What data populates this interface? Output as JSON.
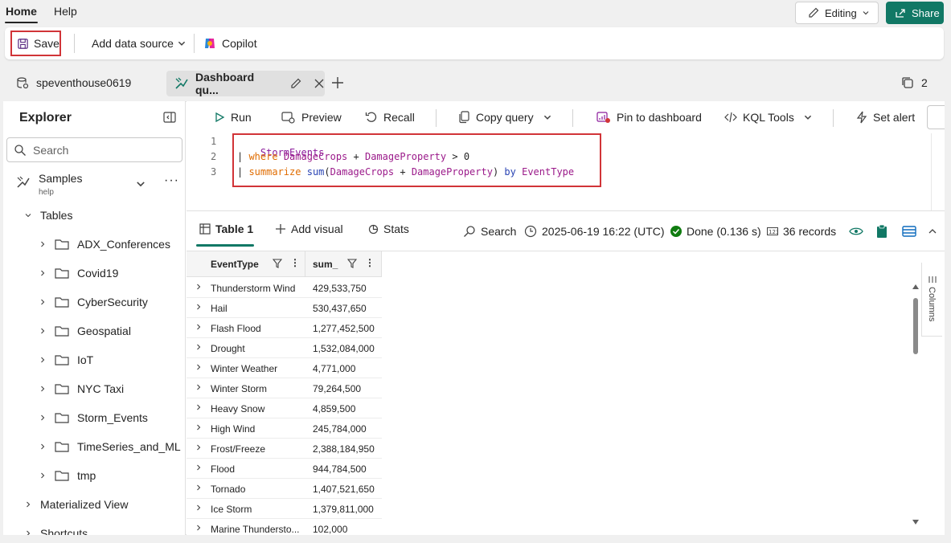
{
  "menubar": {
    "tabs": [
      "Home",
      "Help"
    ],
    "editing_label": "Editing",
    "share_label": "Share"
  },
  "ribbon": {
    "save_label": "Save",
    "add_data_source_label": "Add data source",
    "copilot_label": "Copilot"
  },
  "tabs": {
    "database": "speventhouse0619",
    "queryset": "Dashboard qu...",
    "count": "2"
  },
  "explorer": {
    "title": "Explorer",
    "search_placeholder": "Search",
    "samples_label": "Samples",
    "samples_sub": "help",
    "tables_label": "Tables",
    "tables": [
      "ADX_Conferences",
      "Covid19",
      "CyberSecurity",
      "Geospatial",
      "IoT",
      "NYC Taxi",
      "Storm_Events",
      "TimeSeries_and_ML",
      "tmp"
    ],
    "materialized_view_label": "Materialized View",
    "shortcuts_label": "Shortcuts"
  },
  "toolbar": {
    "run": "Run",
    "preview": "Preview",
    "recall": "Recall",
    "copy_query": "Copy query",
    "pin": "Pin to dashboard",
    "kql_tools": "KQL Tools",
    "set_alert": "Set alert"
  },
  "editor": {
    "line_numbers": [
      "1",
      "2",
      "3"
    ],
    "line1": "StormEvents",
    "line2": {
      "pipe": "| ",
      "op": "where",
      "a": "DamageCrops",
      "plus": " + ",
      "b": "DamageProperty",
      "rest": " > 0"
    },
    "line3": {
      "pipe": "| ",
      "op": "summarize",
      "fn": "sum",
      "open": "(",
      "a": "DamageCrops",
      "plus": " + ",
      "b": "DamageProperty",
      "close": ") ",
      "by": "by",
      "col": "EventType"
    }
  },
  "results": {
    "table_tab": "Table 1",
    "add_visual": "Add visual",
    "stats": "Stats",
    "search": "Search",
    "timestamp": "2025-06-19 16:22 (UTC)",
    "status": "Done (0.136 s)",
    "records": "36 records"
  },
  "grid": {
    "columns": [
      "EventType",
      "sum_"
    ],
    "rows": [
      [
        "Thunderstorm Wind",
        "429,533,750"
      ],
      [
        "Hail",
        "530,437,650"
      ],
      [
        "Flash Flood",
        "1,277,452,500"
      ],
      [
        "Drought",
        "1,532,084,000"
      ],
      [
        "Winter Weather",
        "4,771,000"
      ],
      [
        "Winter Storm",
        "79,264,500"
      ],
      [
        "Heavy Snow",
        "4,859,500"
      ],
      [
        "High Wind",
        "245,784,000"
      ],
      [
        "Frost/Freeze",
        "2,388,184,950"
      ],
      [
        "Flood",
        "944,784,500"
      ],
      [
        "Tornado",
        "1,407,521,650"
      ],
      [
        "Ice Storm",
        "1,379,811,000"
      ],
      [
        "Marine Thundersto...",
        "102,000"
      ]
    ],
    "columns_panel_label": "Columns"
  },
  "colors": {
    "accent": "#117865",
    "highlight": "#d13438"
  }
}
